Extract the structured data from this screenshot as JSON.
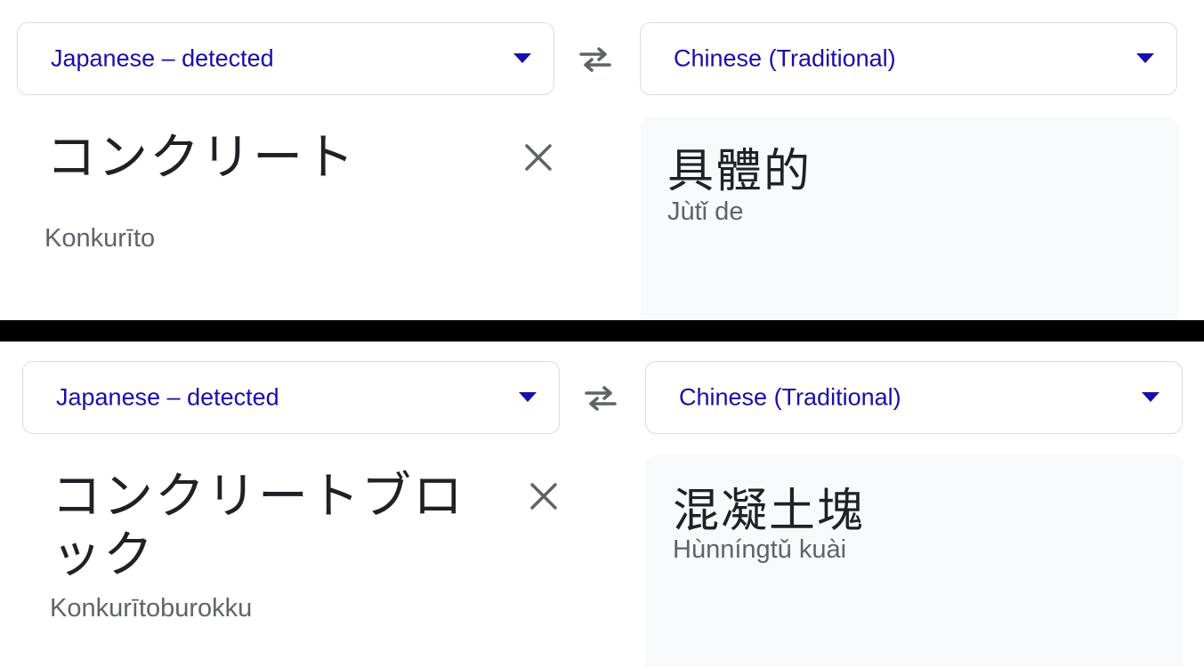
{
  "screens": [
    {
      "source_language": "Japanese – detected",
      "target_language": "Chinese (Traditional)",
      "source_text": "コンクリート",
      "source_romanization": "Konkurīto",
      "translation": "具體的",
      "translation_romanization": "Jùtǐ de"
    },
    {
      "source_language": "Japanese – detected",
      "target_language": "Chinese (Traditional)",
      "source_text": "コンクリートブロック",
      "source_romanization": "Konkurītoburokku",
      "translation": "混凝土塊",
      "translation_romanization": "Hùnníngtǔ kuài"
    }
  ],
  "colors": {
    "accent": "#1a0dab",
    "border": "#dadce0",
    "text": "#202124",
    "muted": "#5f6368",
    "target_bg": "#f8f9fa",
    "divider": "#000000"
  },
  "icons": {
    "swap": "swap-arrows-icon",
    "clear": "close-icon",
    "dropdown": "caret-down-icon"
  }
}
